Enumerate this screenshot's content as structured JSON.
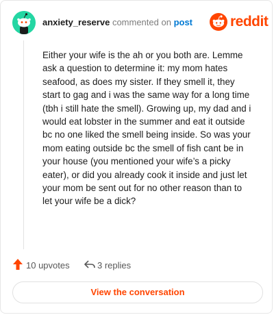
{
  "header": {
    "username": "anxiety_reserve",
    "action_text": "commented on",
    "target_link": "post",
    "brand_name": "reddit"
  },
  "comment": {
    "text": "Either your wife is the ah or you both are. Lemme ask a question to determine it: my mom hates seafood, as does my sister. If they smell it, they start to gag and i was the same way for a long time (tbh i still hate the smell). Growing up, my dad and i would eat lobster in the summer and eat it outside bc no one liked the smell being inside. So was your mom eating outside bc the smell of fish cant be in your house (you mentioned your wife’s a picky eater), or did you already cook it inside and just let your mom be sent out for no other reason than to let your wife be a dick?"
  },
  "actions": {
    "upvotes_label": "10 upvotes",
    "replies_label": "3 replies",
    "upvote_icon": "arrow-up-icon",
    "reply_icon": "reply-icon"
  },
  "cta": {
    "label": "View the conversation"
  },
  "colors": {
    "brand": "#ff4500",
    "link": "#0079d3",
    "avatar_bg": "#24d6a3"
  }
}
